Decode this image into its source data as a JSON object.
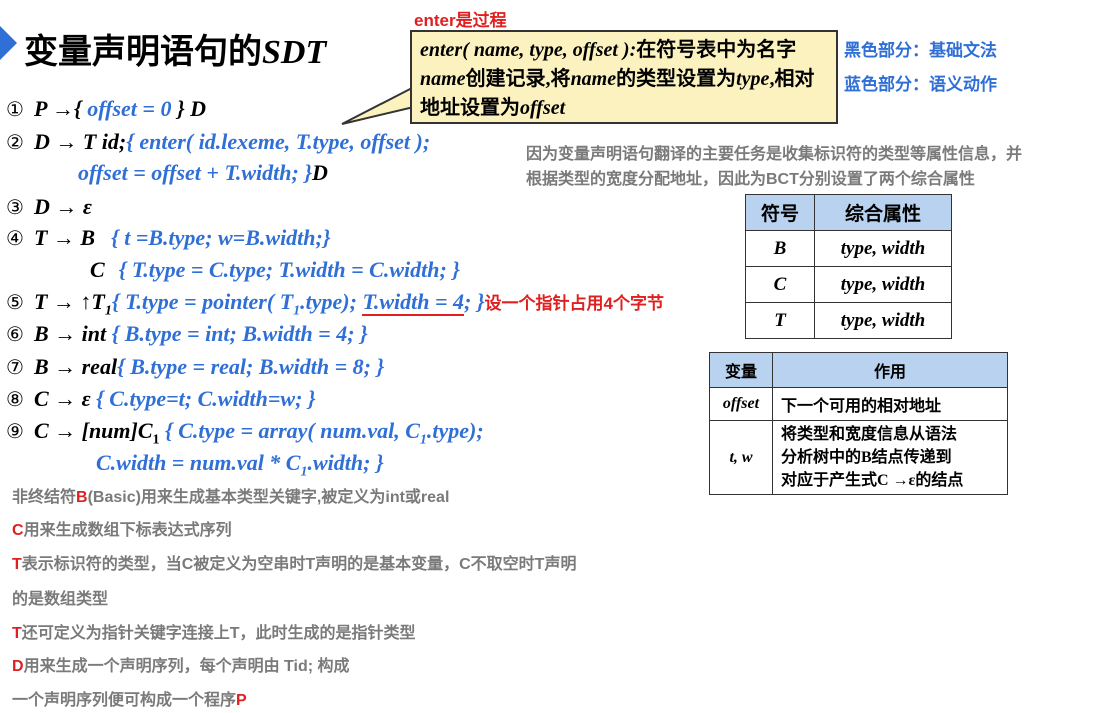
{
  "title": {
    "cn": "变量声明语句的",
    "en": "SDT"
  },
  "enter_note": "enter是过程",
  "callout": {
    "p1": "enter( name, type, offset ):",
    "p2": "在符号表中为名字",
    "p3": "name",
    "p4": "创建记录,将",
    "p5": "name",
    "p6": "的类型设置为",
    "p7": "type",
    "p8": ",相对地址设置为",
    "p9": "offset"
  },
  "legend": {
    "black": "黑色部分：基础文法",
    "blue": "蓝色部分：语义动作"
  },
  "explain_top": {
    "line1": "因为变量声明语句翻译的主要任务是收集标识符的类型等属性信息，并",
    "line2": "根据类型的宽度分配地址，因此为BCT分别设置了两个综合属性"
  },
  "rules": {
    "r1": {
      "num": "①",
      "head": "P →{ ",
      "act": "offset = 0",
      "tail": " } D"
    },
    "r2": {
      "num": "②",
      "head": "D → T id;",
      "act": "{ enter( id.lexeme, T.type, offset );"
    },
    "r2b": {
      "act": "offset = offset + T.width; }",
      "tail": "D"
    },
    "r3": {
      "num": "③",
      "head": "D → ε"
    },
    "r4": {
      "num": "④",
      "head": "T → B",
      "act": "{ t =B.type; w=B.width;}"
    },
    "r4b": {
      "head": "C",
      "act": "{ T.type = C.type; T.width = C.width; }"
    },
    "r5": {
      "num": "⑤",
      "head": "T → ↑T",
      "sub": "1",
      "act1": "{ T.type = pointer( T",
      "sub2": "1",
      "act2": ".type); ",
      "act3": "T.width = 4",
      "act4": "; }"
    },
    "r5note": "设一个指针占用4个字节",
    "r6": {
      "num": "⑥",
      "head": "B → int ",
      "act": "{ B.type = int; B.width = 4; }"
    },
    "r7": {
      "num": "⑦",
      "head": "B → real",
      "act": "{ B.type = real; B.width = 8; }"
    },
    "r8": {
      "num": "⑧",
      "head": "C → ε ",
      "act": "{ C.type=t; C.width=w; }"
    },
    "r9": {
      "num": "⑨",
      "head": "C → [num]C",
      "sub": "1",
      "act1": " { C.type = array( num.val, C",
      "sub2": "1",
      "act2": ".type);"
    },
    "r9b": {
      "act1": "C.width = num.val * C",
      "sub": "1",
      "act2": ".width; }"
    }
  },
  "attr_table": {
    "headers": [
      "符号",
      "综合属性"
    ],
    "rows": [
      [
        "B",
        "type, width"
      ],
      [
        "C",
        "type, width"
      ],
      [
        "T",
        "type, width"
      ]
    ]
  },
  "var_table": {
    "headers": [
      "变量",
      "作用"
    ],
    "rows": [
      [
        "offset",
        "下一个可用的相对地址"
      ],
      [
        "t, w",
        "将类型和宽度信息从语法",
        "分析树中的B结点传递到",
        "对应于产生式C →ε的结点"
      ]
    ]
  },
  "explanations": {
    "e1a": "非终结符",
    "e1b": "B",
    "e1c": "(Basic)用来生成基本类型关键字,被定义为int或real",
    "e2a": "C",
    "e2b": "用来生成数组下标表达式序列",
    "e3a": "T",
    "e3b": "表示标识符的类型，当C被定义为空串时T声明的是基本变量，C不取空时T声明",
    "e4": "的是数组类型",
    "e5a": "T",
    "e5b": "还可定义为指针关键字连接上T，此时生成的是指针类型",
    "e6a": "D",
    "e6b": "用来生成一个声明序列，每个声明由 Tid; 构成",
    "e7a": "一个声明序列便可构成一个程序",
    "e7b": "P"
  },
  "colors": {
    "blue": "#2f6fd6",
    "red": "#e02020",
    "gray": "#7a7a7a",
    "callout_bg": "#fbf2c0",
    "table_header": "#b8d2ef"
  }
}
